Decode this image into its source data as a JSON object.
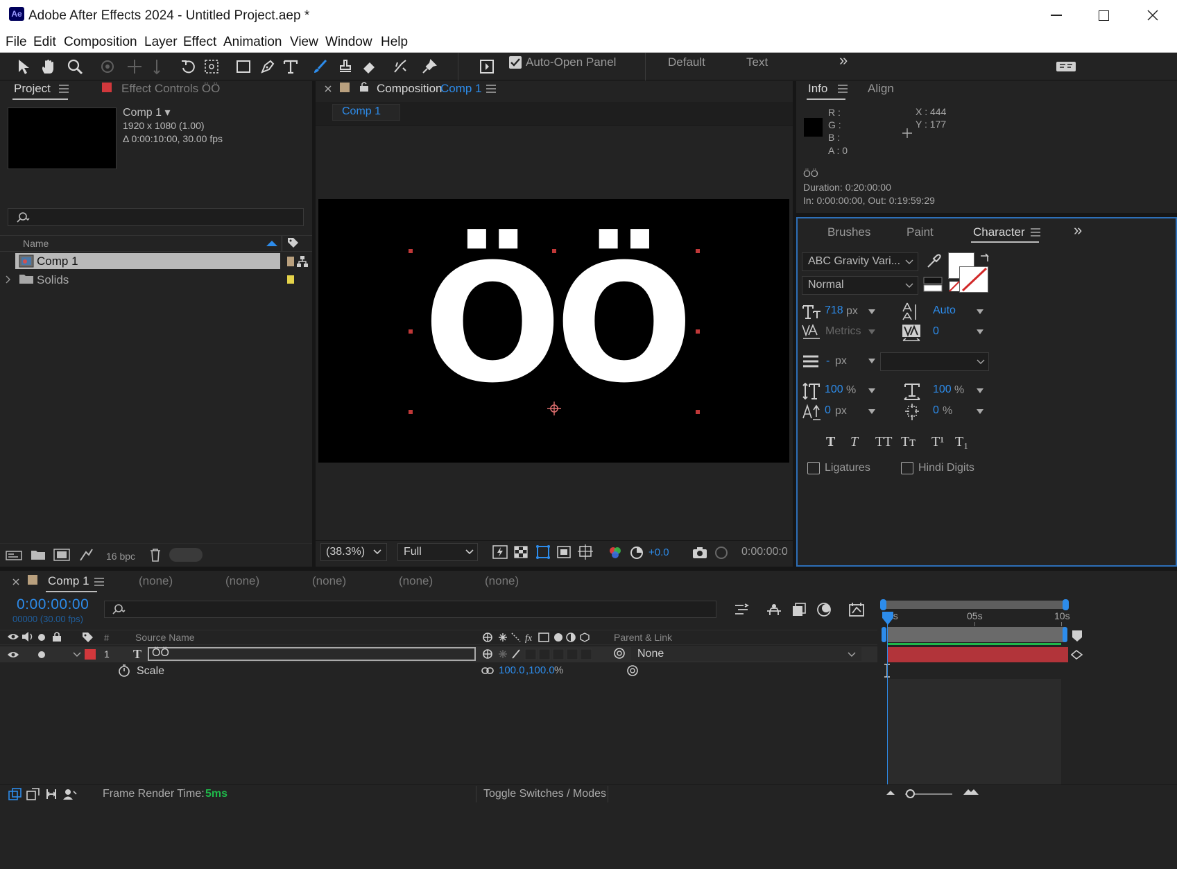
{
  "window": {
    "app_icon": "Ae",
    "title": "Adobe After Effects 2024 - Untitled Project.aep *",
    "minimize": "minimize-icon",
    "maximize": "maximize-icon",
    "close": "close-icon"
  },
  "menu": [
    "File",
    "Edit",
    "Composition",
    "Layer",
    "Effect",
    "Animation",
    "View",
    "Window",
    "Help"
  ],
  "toolbar": {
    "auto_open_label": "Auto-Open Panel",
    "workspaces": [
      "Default",
      "Text"
    ],
    "more": "»"
  },
  "project_panel": {
    "tab_project": "Project",
    "tab_effect_controls": "Effect Controls ÖÖ",
    "comp_name": "Comp 1 ▾",
    "comp_size": "1920 x 1080 (1.00)",
    "comp_duration": "Δ 0:00:10:00, 30.00 fps",
    "search_placeholder": "",
    "col_name": "Name",
    "items": [
      {
        "name": "Comp 1",
        "type": "composition",
        "selected": true,
        "label_color": "#b9a07e"
      },
      {
        "name": "Solids",
        "type": "folder",
        "selected": false,
        "label_color": "#e5d34a"
      }
    ],
    "bpc": "16 bpc"
  },
  "comp_panel": {
    "tab_label": "Composition",
    "tab_comp": "Comp 1",
    "sub_tab": "Comp 1",
    "text_content": "ÖÖ",
    "zoom": "(38.3%)",
    "resolution": "Full",
    "exposure": "+0.0",
    "timecode": "0:00:00:0"
  },
  "info_panel": {
    "tab_info": "Info",
    "tab_align": "Align",
    "r": "R :",
    "g": "G :",
    "b": "B :",
    "a": "A : 0",
    "x": "X : 444",
    "y": "Y : 177",
    "layer_name": "ÖÖ",
    "duration": "Duration: 0:20:00:00",
    "in_out": "In: 0:00:00:00, Out: 0:19:59:29"
  },
  "character_panel": {
    "tab_brushes": "Brushes",
    "tab_paint": "Paint",
    "tab_character": "Character",
    "font": "ABC Gravity Vari...",
    "style": "Normal",
    "font_size": "718",
    "font_size_unit": "px",
    "leading": "Auto",
    "kerning": "Metrics",
    "tracking": "0",
    "stroke_width": "-",
    "stroke_unit": "px",
    "vert_scale": "100",
    "horiz_scale": "100",
    "pct": "%",
    "baseline": "0",
    "baseline_unit": "px",
    "tsume": "0",
    "style_buttons": [
      "T",
      "T",
      "TT",
      "Tт",
      "T¹",
      "T₁"
    ],
    "ligatures": "Ligatures",
    "hindi": "Hindi Digits"
  },
  "timeline": {
    "tab": "Comp 1",
    "none_tabs": [
      "(none)",
      "(none)",
      "(none)",
      "(none)",
      "(none)"
    ],
    "timecode": "0:00:00:00",
    "frames": "00000 (30.00 fps)",
    "col_hash": "#",
    "col_source": "Source Name",
    "col_parent": "Parent & Link",
    "layer_num": "1",
    "layer_name": "ÖÖ",
    "parent_value": "None",
    "prop_scale": "Scale",
    "scale_x": "100.0",
    "scale_y": ",100.0",
    "scale_unit": "%",
    "ruler": [
      "0s",
      "05s",
      "10s"
    ],
    "render_label": "Frame Render Time:",
    "render_value": "5ms",
    "toggle_label": "Toggle Switches / Modes"
  },
  "colors": {
    "accent_blue": "#2d8ceb",
    "label_red": "#d1383c",
    "layer_bar": "#b2343a",
    "timeline_green": "#1fb84a"
  }
}
